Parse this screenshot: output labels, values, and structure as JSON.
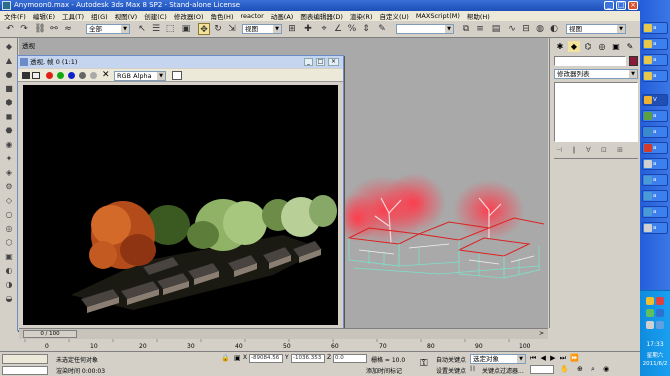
{
  "window": {
    "title": "Anymoon0.max - Autodesk 3ds Max 8 SP2 - Stand-alone License"
  },
  "menu": [
    "文件(F)",
    "编辑(E)",
    "工具(T)",
    "组(G)",
    "视图(V)",
    "创建(C)",
    "修改器(O)",
    "角色(H)",
    "reactor",
    "动画(A)",
    "图表编辑器(D)",
    "渲染(R)",
    "自定义(U)",
    "MAXScript(M)",
    "帮助(H)"
  ],
  "toolbar": {
    "selection_filter": "全部",
    "ref_coord": "视图",
    "named_selection": "",
    "right_dropdown": "视图"
  },
  "viewport": {
    "label": "透视"
  },
  "render_window": {
    "title": "透视, 帧 0 (1:1)",
    "channel": "RGB Alpha"
  },
  "command_panel": {
    "modifier_list": "修改器列表"
  },
  "timeline": {
    "frame_counter": "0 / 100",
    "ticks": [
      "0",
      "10",
      "20",
      "30",
      "40",
      "50",
      "60",
      "70",
      "80",
      "90",
      "100"
    ]
  },
  "status": {
    "selection": "未选定任何对象",
    "render_time": "渲染时间 0:00:03",
    "x_value": "-89084.56",
    "y_value": "-1036.353",
    "z_value": "0.0",
    "grid": "栅格 = 10.0",
    "add_time_tag": "添加时间标记",
    "auto_key": "自动关键点",
    "set_key": "设置关键点",
    "key_mode": "选定对象",
    "key_filters": "关键点过滤器..."
  },
  "taskbar": {
    "items": [
      "a",
      "a",
      "a",
      "a",
      "V",
      "a",
      "a",
      "a",
      "a",
      "a",
      "a",
      "a",
      "a"
    ],
    "clock": "17:33",
    "weekday": "星期六",
    "date": "2011/6/2"
  },
  "colors": {
    "title_blue": "#1c4fb8",
    "taskbar_blue": "#245edb",
    "viewport_gray": "#a9a9a9"
  }
}
